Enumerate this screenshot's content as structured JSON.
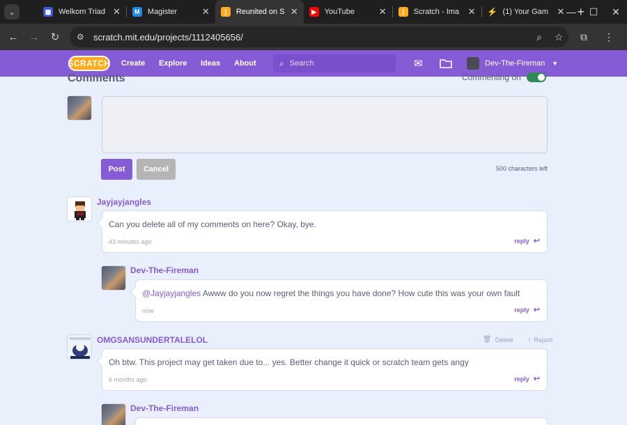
{
  "browser": {
    "tabs": [
      {
        "title": "Welkom Triad",
        "favicon_color": "#3b5bdb",
        "active": false
      },
      {
        "title": "Magister",
        "favicon_color": "#1e88e5",
        "active": false
      },
      {
        "title": "Reunited on S",
        "favicon_color": "#ffab1a",
        "active": true
      },
      {
        "title": "YouTube",
        "favicon_color": "#ff0000",
        "active": false
      },
      {
        "title": "Scratch - Ima",
        "favicon_color": "#ffab1a",
        "active": false
      },
      {
        "title": "(1) Your Gam",
        "favicon_color": "#1f1f1f",
        "active": false
      }
    ],
    "url": "scratch.mit.edu/projects/1112405656/"
  },
  "scratch_nav": {
    "logo": "SCRATCH",
    "links": [
      "Create",
      "Explore",
      "Ideas",
      "About"
    ],
    "search_placeholder": "Search",
    "username": "Dev-The-Fireman"
  },
  "comments_section": {
    "heading": "Comments",
    "commenting_label": "Commenting on",
    "post_label": "Post",
    "cancel_label": "Cancel",
    "chars_left": "500 characters left"
  },
  "comments": [
    {
      "username": "Jayjayjangles",
      "text": "Can you delete all of my comments on here? Okay, bye.",
      "time": "43 minutes ago",
      "reply": "reply"
    },
    {
      "username": "Dev-The-Fireman",
      "mention": "@Jayjayjangles",
      "text": " Awww do you now regret the things you have done? How cute this was your own fault",
      "time": "now",
      "reply": "reply"
    },
    {
      "username": "OMGSANSUNDERTALELOL",
      "text": "Oh btw. This project may get taken due to... yes. Better change it quick or scratch team gets angy",
      "time": "6 months ago",
      "reply": "reply",
      "delete": "Delete",
      "report": "Report"
    },
    {
      "username": "Dev-The-Fireman"
    }
  ],
  "colors": {
    "accent": "#855cd6",
    "page_bg": "#e9f0fc",
    "text": "#575e75"
  }
}
